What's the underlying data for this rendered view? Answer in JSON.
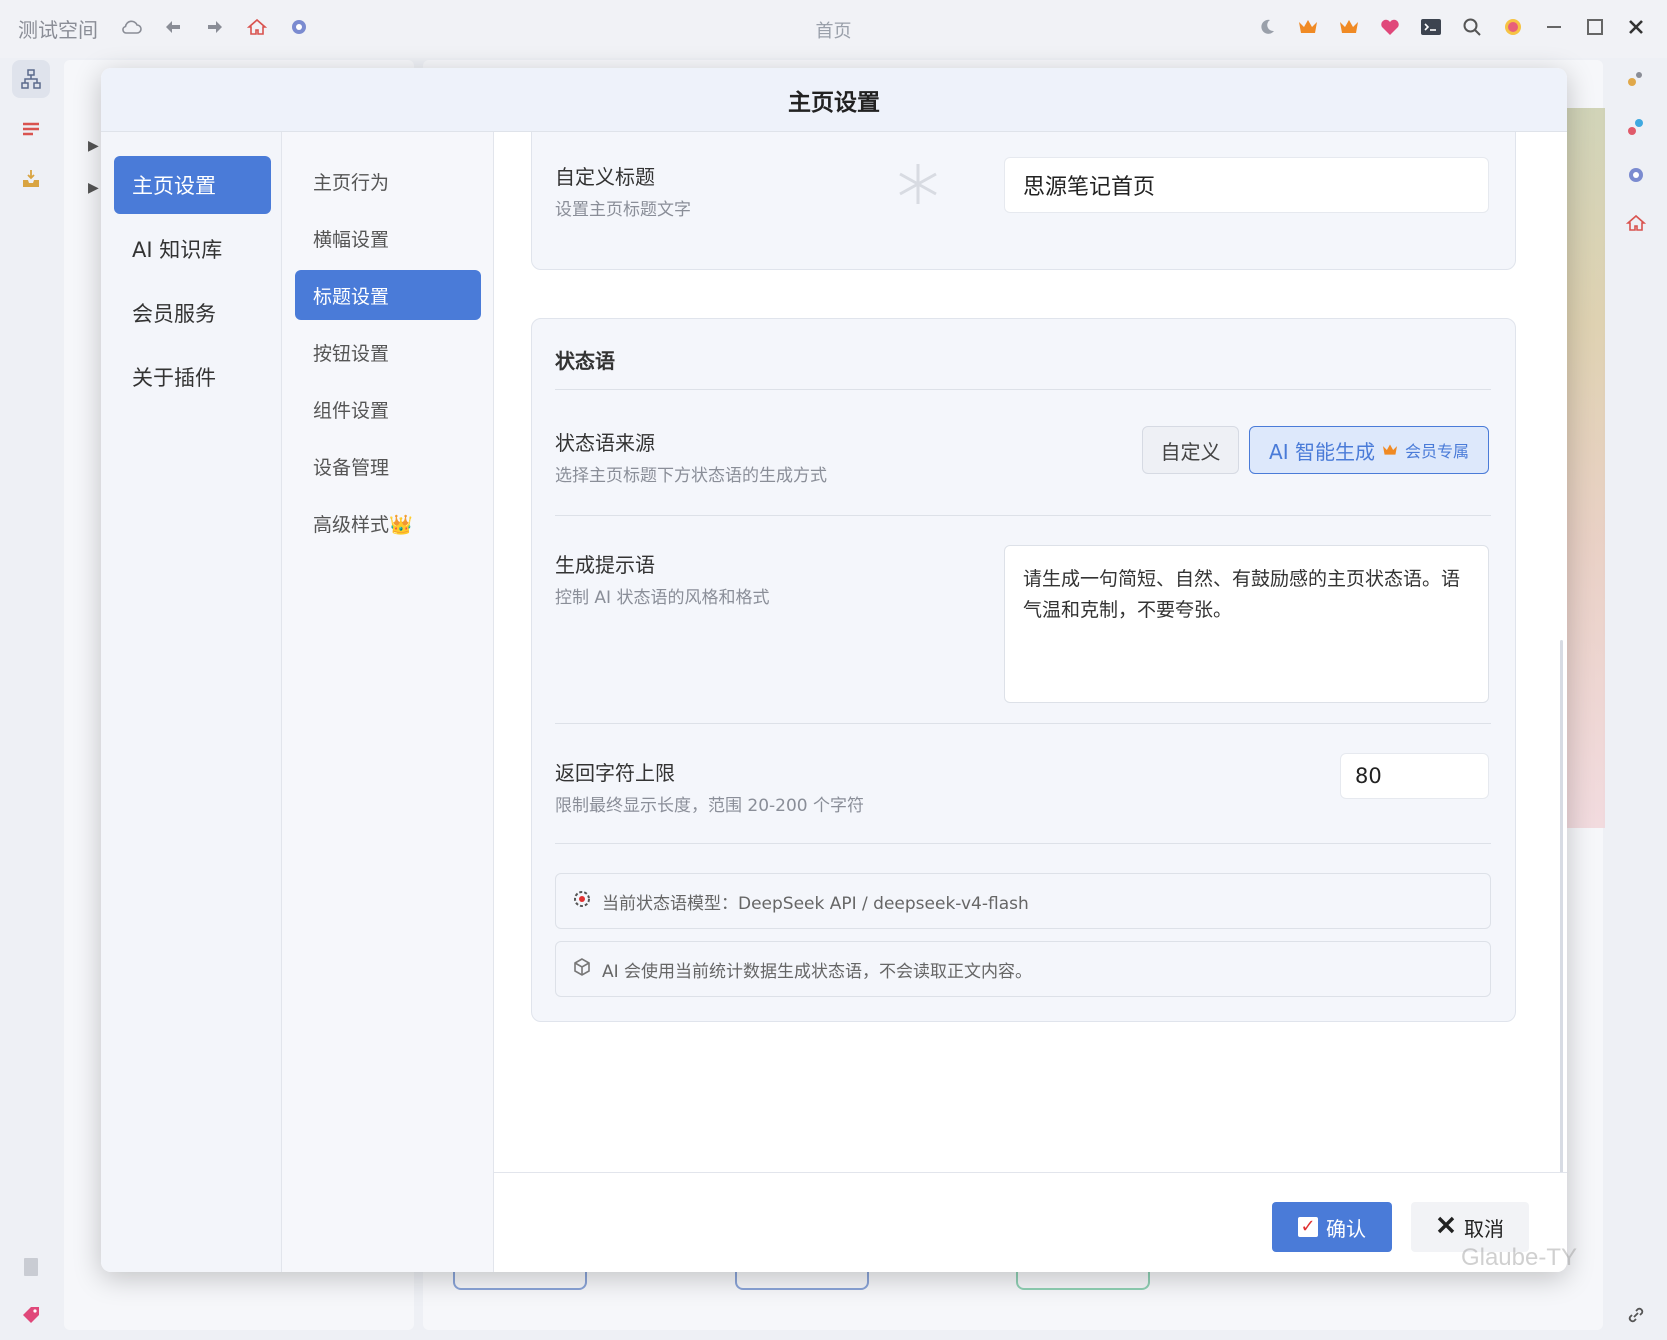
{
  "titlebar": {
    "workspace": "测试空间",
    "center_title": "首页",
    "left_icons": [
      "cloud-icon",
      "back-arrow-icon",
      "forward-arrow-icon",
      "home-icon",
      "plugin-icon"
    ],
    "right_icons": [
      "moon-icon",
      "crown-icon",
      "crown-icon",
      "heart-icon",
      "terminal-icon",
      "search-icon",
      "emoji-icon",
      "minimize-icon",
      "maximize-icon",
      "close-icon"
    ]
  },
  "dialog": {
    "title": "主页设置",
    "nav_primary": [
      {
        "label": "主页设置",
        "active": true
      },
      {
        "label": "AI 知识库",
        "active": false
      },
      {
        "label": "会员服务",
        "active": false
      },
      {
        "label": "关于插件",
        "active": false
      }
    ],
    "nav_secondary": [
      {
        "label": "主页行为",
        "active": false
      },
      {
        "label": "横幅设置",
        "active": false
      },
      {
        "label": "标题设置",
        "active": true
      },
      {
        "label": "按钮设置",
        "active": false
      },
      {
        "label": "组件设置",
        "active": false
      },
      {
        "label": "设备管理",
        "active": false
      },
      {
        "label": "高级样式👑",
        "active": false
      }
    ],
    "custom_title": {
      "title": "自定义标题",
      "subtitle": "设置主页标题文字",
      "value": "思源笔记首页"
    },
    "status_section": {
      "heading": "状态语",
      "source": {
        "title": "状态语来源",
        "subtitle": "选择主页标题下方状态语的生成方式",
        "option_custom": "自定义",
        "option_ai": "AI 智能生成",
        "member_badge": "会员专属",
        "selected": "AI 智能生成"
      },
      "prompt": {
        "title": "生成提示语",
        "subtitle": "控制 AI 状态语的风格和格式",
        "value": "请生成一句简短、自然、有鼓励感的主页状态语。语气温和克制，不要夸张。"
      },
      "limit": {
        "title": "返回字符上限",
        "subtitle": "限制最终显示长度，范围 20-200 个字符",
        "value": "80"
      },
      "model_info": "当前状态语模型：DeepSeek API / deepseek-v4-flash",
      "privacy_info": "AI 会使用当前统计数据生成状态语，不会读取正文内容。"
    },
    "footer": {
      "confirm": "确认",
      "cancel": "取消"
    }
  },
  "watermark": "Glaube-TY",
  "colors": {
    "accent": "#4a7bd8",
    "crown": "#f08a24",
    "danger": "#e03131"
  }
}
